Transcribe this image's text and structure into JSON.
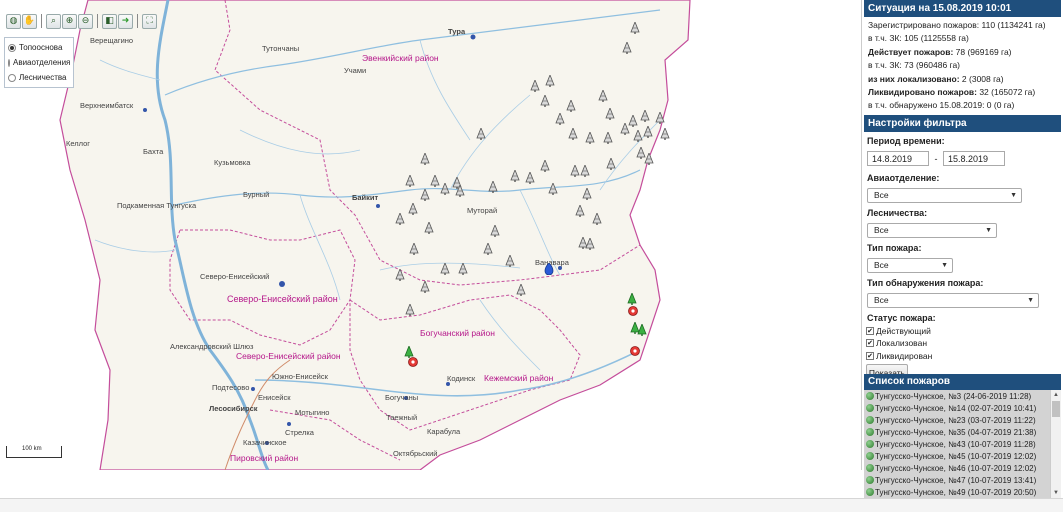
{
  "toolbar": {
    "tools": [
      "globe-icon",
      "hand-pan-icon",
      "zoom-rect-icon",
      "zoom-in-icon",
      "zoom-out-icon",
      "previous-extent-icon",
      "next-extent-icon",
      "full-extent-icon"
    ]
  },
  "layers": {
    "items": [
      {
        "label": "Топооснова",
        "selected": true
      },
      {
        "label": "Авиаотделения",
        "selected": false
      },
      {
        "label": "Лесничества",
        "selected": false
      }
    ]
  },
  "map": {
    "scale_label": "100 km",
    "places": [
      "Верещагино",
      "Тутончаны",
      "Тура",
      "Учами",
      "Верхнеимбатск",
      "Келлог",
      "Бахта",
      "Кузьмовка",
      "Подкаменная Тунгуска",
      "Бурный",
      "Байкит",
      "Муторай",
      "Ванавара",
      "Северо-Енисейский",
      "Александровский Шлюз",
      "Южно-Енисейск",
      "Подтесово",
      "Енисейск",
      "Лесосибирск",
      "Мотыгино",
      "Кодинск",
      "Богучаны",
      "Таежный",
      "Стрелка",
      "Казачинское",
      "Карабула",
      "Октябрьский"
    ],
    "regions": [
      "Эвенкийский район",
      "Северо-Енисейский район",
      "Северо-Енисейский район",
      "Богучанский район",
      "Кежемский район",
      "Пировский район"
    ]
  },
  "situation": {
    "header": "Ситуация на 15.08.2019 10:01",
    "lines": [
      {
        "label": "Зарегистрировано пожаров:",
        "value": " 110 (1134241 га)"
      },
      {
        "label": "в т.ч. ЗК:",
        "value": " 105 (1125558 га)"
      },
      {
        "label": "Действует пожаров:",
        "value": " 78 (969169 га)"
      },
      {
        "label": "в т.ч. ЗК:",
        "value": " 73 (960486 га)"
      },
      {
        "label": "из них локализовано:",
        "value": " 2 (3008 га)"
      },
      {
        "label": "Ликвидировано пожаров:",
        "value": " 32 (165072 га)"
      },
      {
        "label": "в т.ч. обнаружено 15.08.2019:",
        "value": " 0 (0 га)"
      }
    ]
  },
  "filter": {
    "header": "Настройки фильтра",
    "period_label": "Период времени:",
    "date_from": "14.8.2019",
    "date_sep": "-",
    "date_to": "15.8.2019",
    "avia_label": "Авиаотделение:",
    "avia_value": "Все",
    "forestry_label": "Лесничества:",
    "forestry_value": "Все",
    "type_label": "Тип пожара:",
    "type_value": "Все",
    "detect_label": "Тип обнаружения пожара:",
    "detect_value": "Все",
    "status_label": "Статус пожара:",
    "statuses": [
      {
        "label": "Действующий",
        "checked": true
      },
      {
        "label": "Локализован",
        "checked": true
      },
      {
        "label": "Ликвидирован",
        "checked": true
      }
    ],
    "show_button": "Показать"
  },
  "fire_list": {
    "header": "Список пожаров",
    "items": [
      "Тунгусско-Чунское, №3 (24-06-2019 11:28)",
      "Тунгусско-Чунское, №14 (02-07-2019 10:41)",
      "Тунгусско-Чунское, №23 (03-07-2019 11:22)",
      "Тунгусско-Чунское, №35 (04-07-2019 21:38)",
      "Тунгусско-Чунское, №43 (10-07-2019 11:28)",
      "Тунгусско-Чунское, №45 (10-07-2019 12:02)",
      "Тунгусско-Чунское, №46 (10-07-2019 12:02)",
      "Тунгусско-Чунское, №47 (10-07-2019 13:41)",
      "Тунгусско-Чунское, №49 (10-07-2019 20:50)"
    ]
  }
}
